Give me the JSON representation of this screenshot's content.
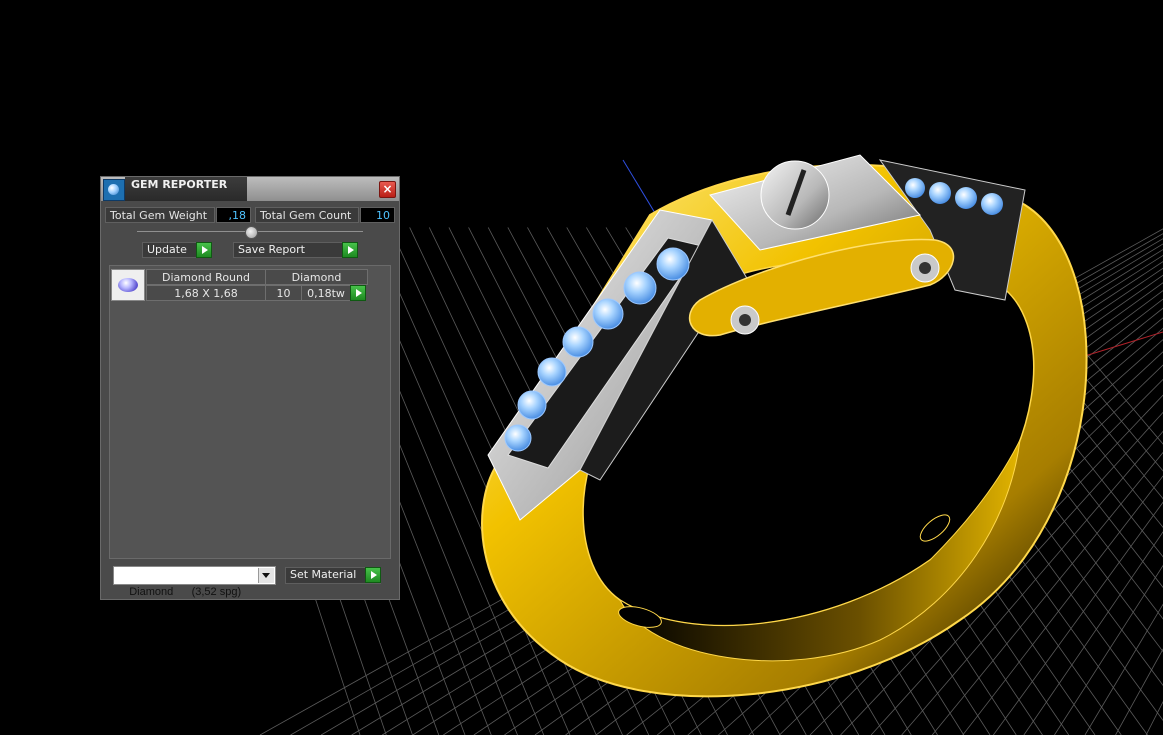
{
  "window": {
    "title": "GEM REPORTER",
    "close_label": "×"
  },
  "stats": {
    "weight_label": "Total Gem Weight",
    "weight_value": ",18",
    "count_label": "Total Gem Count",
    "count_value": "10"
  },
  "actions": {
    "update_label": "Update",
    "save_label": "Save Report"
  },
  "gem_list": {
    "columns": [
      "Diamond Round",
      "Diamond"
    ],
    "rows": [
      {
        "size": "1,68 X 1,68",
        "count": "10",
        "weight": "0,18tw"
      }
    ]
  },
  "material": {
    "selected": "Diamond      (3,52 spg)",
    "set_label": "Set Material"
  },
  "colors": {
    "accent_value": "#4fc3ff",
    "metal_gold": "#f2c200",
    "grid": "#5a5a5a"
  },
  "icons": [
    "gem-reporter-app-icon",
    "close-icon",
    "play-icon",
    "diamond-gem-icon",
    "dropdown-arrow-icon"
  ]
}
